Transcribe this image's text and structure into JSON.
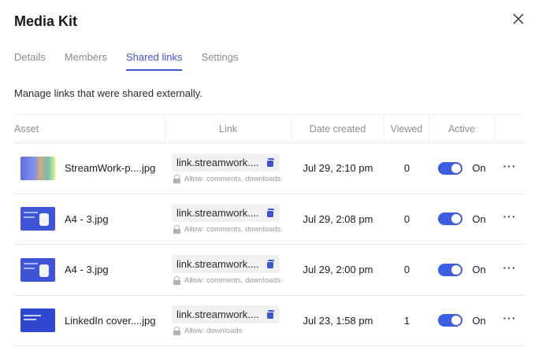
{
  "dialog": {
    "title": "Media Kit",
    "close_icon": "close-icon"
  },
  "tabs": [
    {
      "label": "Details",
      "active": false
    },
    {
      "label": "Members",
      "active": false
    },
    {
      "label": "Shared links",
      "active": true
    },
    {
      "label": "Settings",
      "active": false
    }
  ],
  "description": "Manage links that were shared externally.",
  "table": {
    "headers": {
      "asset": "Asset",
      "link": "Link",
      "date": "Date created",
      "viewed": "Viewed",
      "active": "Active"
    },
    "rows": [
      {
        "asset": "StreamWork-p....jpg",
        "link": "link.streamwork....",
        "allow": "Allow: comments, downloads",
        "date": "Jul 29, 2:10 pm",
        "viewed": "0",
        "active_label": "On",
        "active": true
      },
      {
        "asset": "A4 - 3.jpg",
        "link": "link.streamwork....",
        "allow": "Allow: comments, downloads",
        "date": "Jul 29, 2:08 pm",
        "viewed": "0",
        "active_label": "On",
        "active": true
      },
      {
        "asset": "A4 - 3.jpg",
        "link": "link.streamwork....",
        "allow": "Allow: comments, downloads",
        "date": "Jul 29, 2:00 pm",
        "viewed": "0",
        "active_label": "On",
        "active": true
      },
      {
        "asset": "LinkedIn cover....jpg",
        "link": "link.streamwork....",
        "allow": "Allow: downloads",
        "date": "Jul 23, 1:58 pm",
        "viewed": "1",
        "active_label": "On",
        "active": true
      }
    ],
    "more_icon": "more-horizontal-icon"
  },
  "colors": {
    "accent": "#3b52d9",
    "toggle_on": "#3b5ee0",
    "muted_text": "#8a8a90"
  }
}
